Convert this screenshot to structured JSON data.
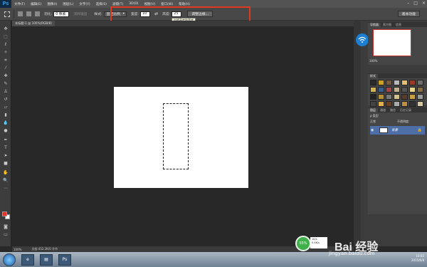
{
  "menubar": {
    "logo": "Ps",
    "items": [
      "文件(F)",
      "编辑(E)",
      "图像(I)",
      "图层(L)",
      "文字(Y)",
      "选择(S)",
      "滤镜(T)",
      "3D(D)",
      "视图(V)",
      "窗口(W)",
      "帮助(H)"
    ],
    "window_controls": [
      "–",
      "□",
      "×"
    ]
  },
  "options": {
    "feather_label": "羽化:",
    "feather_value": "0 像素",
    "antialias_label": "消除锯齿",
    "style_label": "样式:",
    "style_value": "固定比例",
    "width_label": "宽度:",
    "width_value": "10",
    "swap_icon": "⇄",
    "height_label": "高度:",
    "height_value": "25",
    "refine_edge": "调整边缘...",
    "workspace": "基本功能",
    "tooltip": "交换高度和宽度"
  },
  "document": {
    "tab_title": "未标题-1 @ 100%(RGB/8)",
    "zoom": "100%",
    "status": "文档:452.2K/0 字节"
  },
  "panels": {
    "navigator_tabs": [
      "导航器",
      "直方图",
      "信息"
    ],
    "navigator_zoom": "100%",
    "styles_tab": "样式",
    "layers_tabs": [
      "图层",
      "通道",
      "路径",
      "历史记录"
    ],
    "kind_label": "ρ 类型",
    "blend_mode": "正常",
    "opacity_label": "不透明度:",
    "lock_label": "锁定:",
    "fill_label": "填充:",
    "layer_name": "背景"
  },
  "style_colors": [
    "#2a2a2a",
    "#c9a227",
    "#7b5a3a",
    "#b9b9b9",
    "#e0c070",
    "#9a3b2a",
    "#6e6e6e",
    "#d6b14d",
    "#3b5f8a",
    "#a44",
    "#c0b090",
    "#555",
    "#e8d38a",
    "#8b6e3e",
    "#222",
    "#b0903a",
    "#7a7a7a",
    "#d2c090",
    "#5a3a2a",
    "#c8a040",
    "#999",
    "#444",
    "#e0b050",
    "#704020",
    "#aaa",
    "#c09040",
    "#333",
    "#d8c8a0"
  ],
  "taskbar": {
    "app_label": "Ps",
    "clock_time": "10:02",
    "clock_date": "2015/6/8"
  },
  "overlay": {
    "speed_percent": "55%",
    "upload": "1K/s",
    "download": "0.4K/s",
    "watermark_brand": "Bai 经验",
    "watermark_url": "jingyan.baidu.com"
  }
}
